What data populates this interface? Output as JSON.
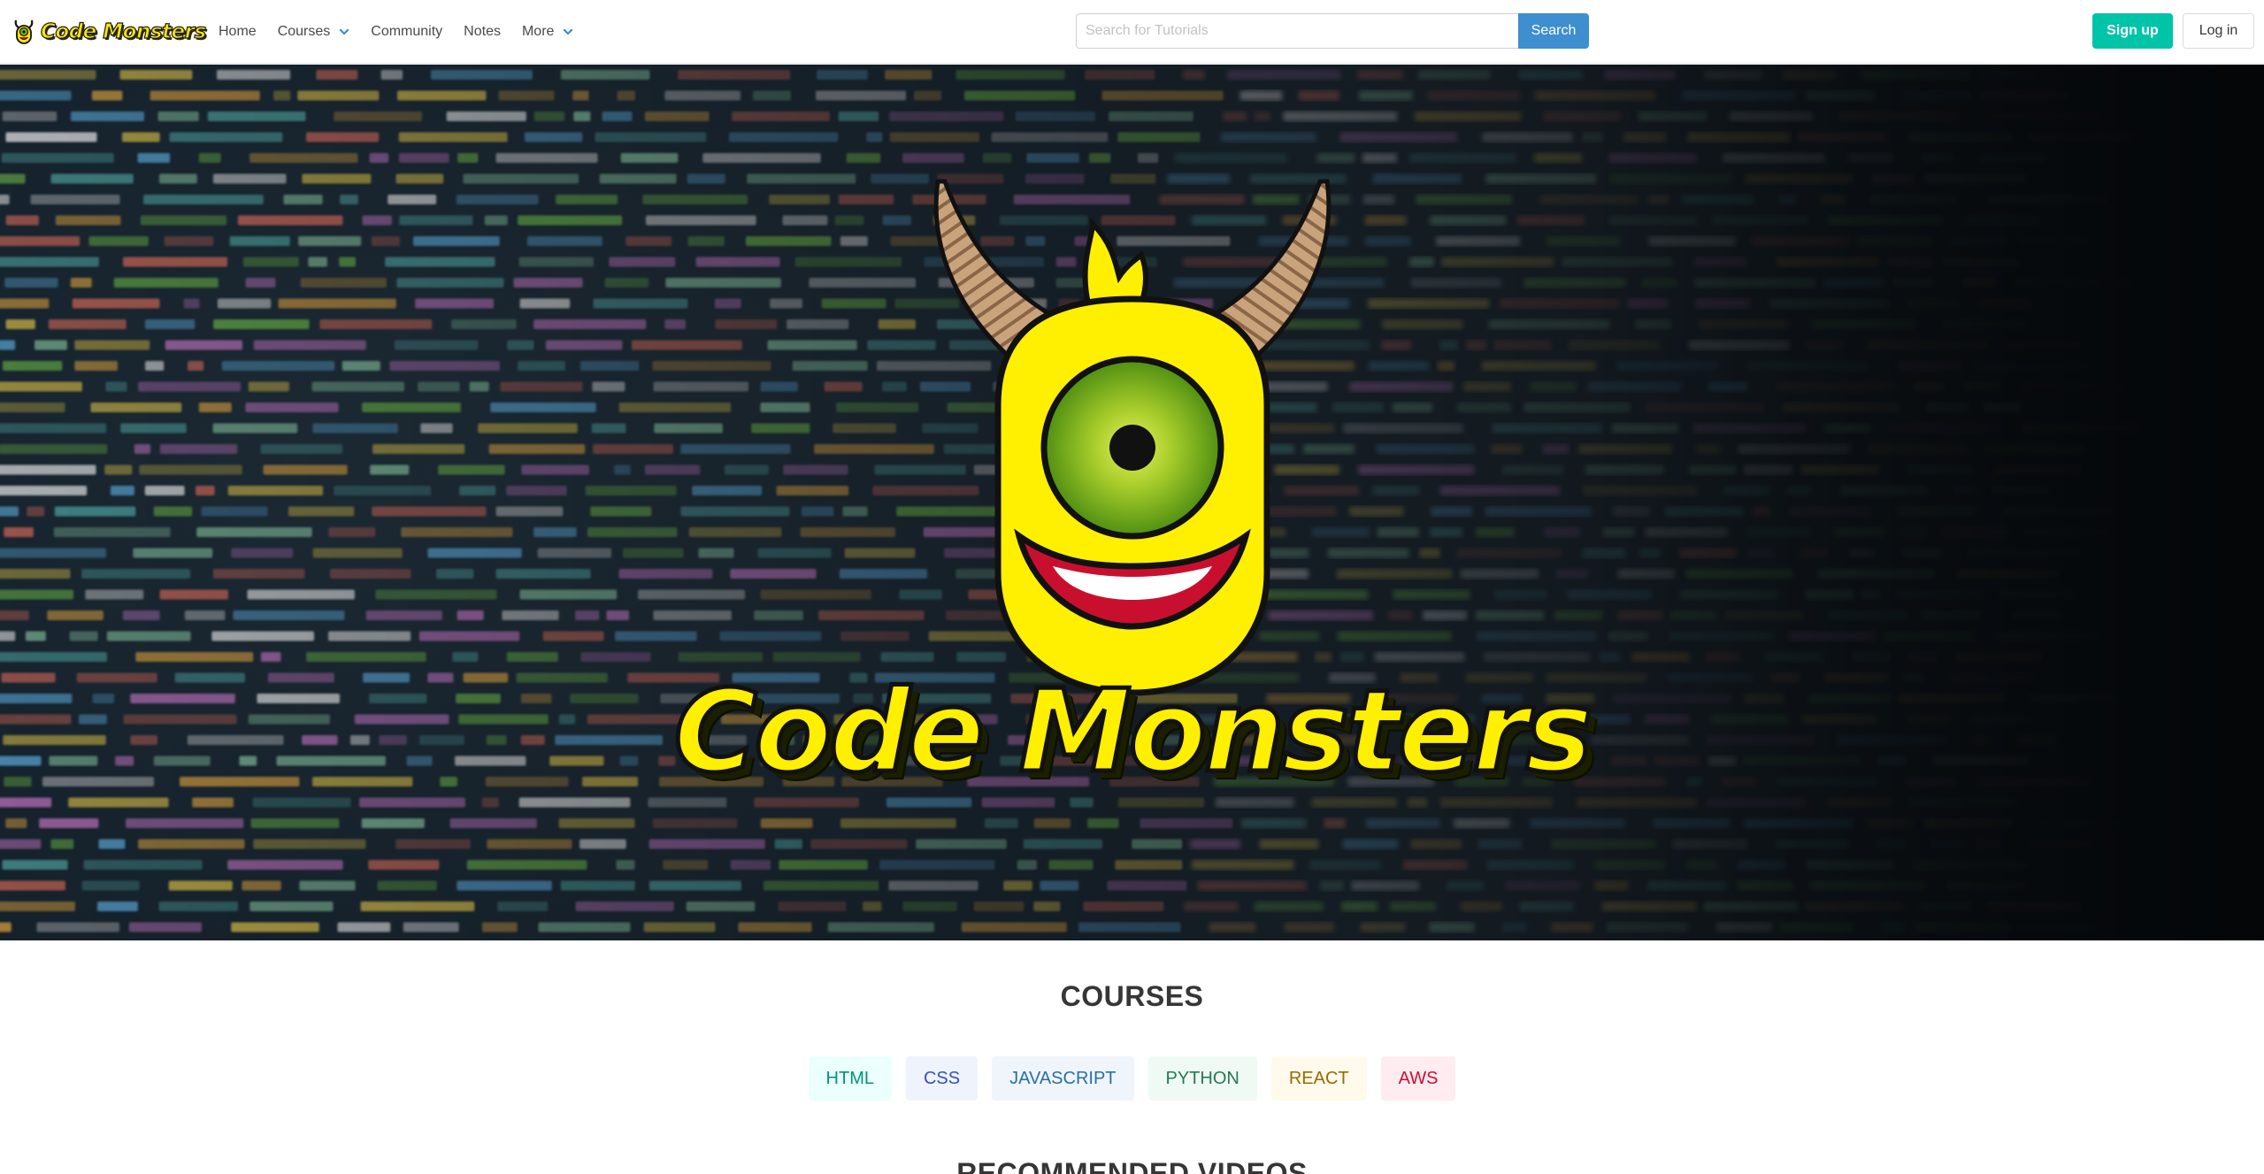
{
  "brand": {
    "name": "Code Monsters"
  },
  "nav": {
    "links": [
      {
        "label": "Home"
      },
      {
        "label": "Courses"
      },
      {
        "label": "Community"
      },
      {
        "label": "Notes"
      },
      {
        "label": "More"
      }
    ]
  },
  "search": {
    "placeholder": "Search for Tutorials",
    "button_label": "Search"
  },
  "auth": {
    "signup_label": "Sign up",
    "login_label": "Log in"
  },
  "hero": {
    "title": "Code Monsters"
  },
  "courses": {
    "title": "COURSES",
    "tags": [
      {
        "label": "HTML"
      },
      {
        "label": "CSS"
      },
      {
        "label": "JAVASCRIPT"
      },
      {
        "label": "PYTHON"
      },
      {
        "label": "REACT"
      },
      {
        "label": "AWS"
      }
    ]
  },
  "recommended": {
    "title": "RECOMMENDED VIDEOS"
  },
  "colors": {
    "primary": "#3e8ed0",
    "signup": "#00c4a7",
    "mascot_yellow": "#ffef00",
    "eye_green": "#7ab317"
  }
}
